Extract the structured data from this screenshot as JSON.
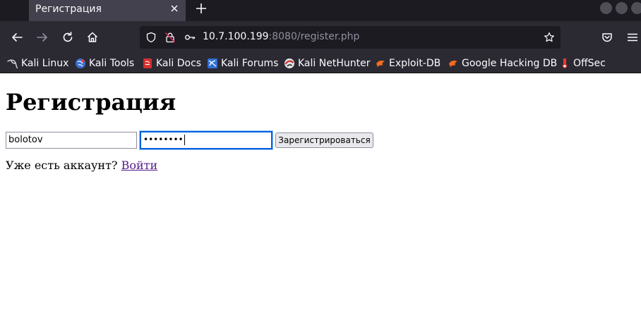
{
  "browser": {
    "tab": {
      "title": "Регистрация"
    },
    "address": {
      "host": "10.7.100.199",
      "rest": ":8080/register.php"
    },
    "bookmarks": [
      {
        "label": "Kali Linux",
        "icon": "kali-dragon-icon"
      },
      {
        "label": "Kali Tools",
        "icon": "kali-tools-icon"
      },
      {
        "label": "Kali Docs",
        "icon": "kali-docs-icon"
      },
      {
        "label": "Kali Forums",
        "icon": "kali-forums-icon"
      },
      {
        "label": "Kali NetHunter",
        "icon": "kali-nethunter-icon"
      },
      {
        "label": "Exploit-DB",
        "icon": "exploit-db-icon"
      },
      {
        "label": "Google Hacking DB",
        "icon": "google-hacking-db-icon"
      },
      {
        "label": "OffSec",
        "icon": "offsec-icon"
      }
    ]
  },
  "page": {
    "heading": "Регистрация",
    "form": {
      "username_value": "bolotov",
      "password_mask": "••••••••",
      "submit_label": "Зарегистрироваться"
    },
    "login_prompt": "Уже есть аккаунт?",
    "login_link": "Войти"
  },
  "colors": {
    "tabstrip": "#1c1b22",
    "toolbar": "#2b2a33",
    "focus_ring": "#0060df",
    "link_visited": "#551a8b"
  }
}
